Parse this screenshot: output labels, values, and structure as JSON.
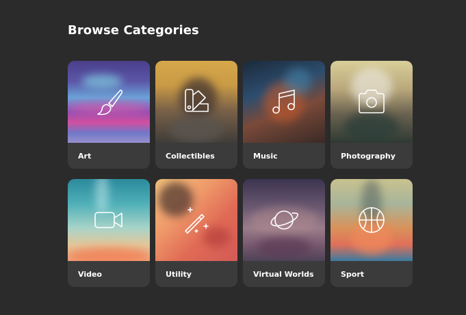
{
  "page": {
    "title": "Browse Categories"
  },
  "categories": [
    {
      "label": "Art",
      "icon": "paintbrush-icon"
    },
    {
      "label": "Collectibles",
      "icon": "color-swatch-icon"
    },
    {
      "label": "Music",
      "icon": "music-note-icon"
    },
    {
      "label": "Photography",
      "icon": "camera-icon"
    },
    {
      "label": "Video",
      "icon": "video-camera-icon"
    },
    {
      "label": "Utility",
      "icon": "magic-wand-icon"
    },
    {
      "label": "Virtual Worlds",
      "icon": "planet-icon"
    },
    {
      "label": "Sport",
      "icon": "basketball-icon"
    }
  ],
  "colors": {
    "background": "#2b2b2b",
    "card": "#3b3b3b",
    "text": "#ffffff"
  }
}
